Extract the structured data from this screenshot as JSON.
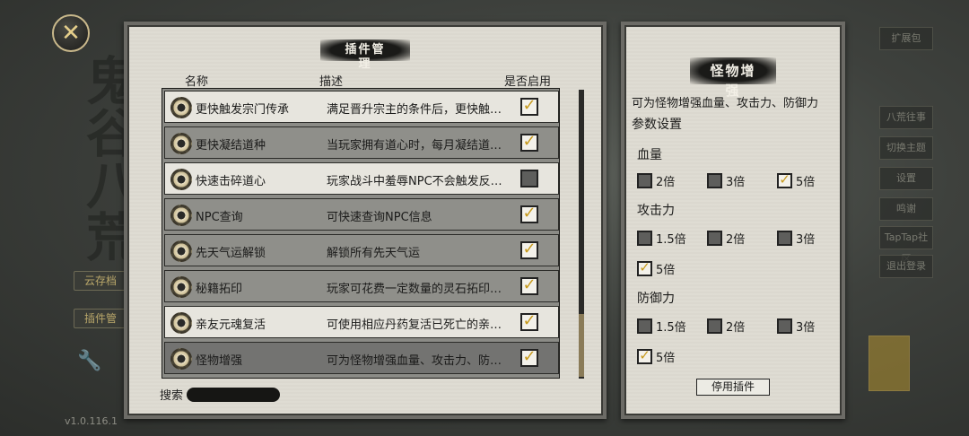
{
  "close_icon": "close-icon",
  "background": {
    "left_art": "鬼谷八荒",
    "side_buttons": [
      "云存档",
      "插件管"
    ],
    "right_buttons": [
      "扩展包",
      "八荒往事",
      "切换主题",
      "设置",
      "鸣谢",
      "TapTap社区",
      "退出登录"
    ],
    "version": "v1.0.116.1"
  },
  "main_panel": {
    "title": "插件管理",
    "columns": {
      "name": "名称",
      "desc": "描述",
      "enabled": "是否启用"
    },
    "plugins": [
      {
        "name": "更快触发宗门传承",
        "desc": "满足晋升宗主的条件后，更快触…",
        "enabled": true,
        "style": "light"
      },
      {
        "name": "更快凝结道种",
        "desc": "当玩家拥有道心时，每月凝结道…",
        "enabled": true,
        "style": "dark"
      },
      {
        "name": "快速击碎道心",
        "desc": "玩家战斗中羞辱NPC不会触发反…",
        "enabled": false,
        "style": "light"
      },
      {
        "name": "NPC查询",
        "desc": "可快速查询NPC信息",
        "enabled": true,
        "style": "dark"
      },
      {
        "name": "先天气运解锁",
        "desc": "解锁所有先天气运",
        "enabled": true,
        "style": "dark"
      },
      {
        "name": "秘籍拓印",
        "desc": "玩家可花费一定数量的灵石拓印…",
        "enabled": true,
        "style": "dark"
      },
      {
        "name": "亲友元魂复活",
        "desc": "可使用相应丹药复活已死亡的亲…",
        "enabled": true,
        "style": "light"
      },
      {
        "name": "怪物增强",
        "desc": "可为怪物增强血量、攻击力、防…",
        "enabled": true,
        "style": "selected"
      }
    ],
    "search_label": "搜索",
    "search_value": ""
  },
  "side_panel": {
    "title": "怪物增强",
    "desc": "可为怪物增强血量、攻击力、防御力",
    "params_label": "参数设置",
    "groups": [
      {
        "label": "血量",
        "options": [
          {
            "label": "2倍",
            "checked": false
          },
          {
            "label": "3倍",
            "checked": false
          },
          {
            "label": "5倍",
            "checked": true
          }
        ]
      },
      {
        "label": "攻击力",
        "options": [
          {
            "label": "1.5倍",
            "checked": false
          },
          {
            "label": "2倍",
            "checked": false
          },
          {
            "label": "3倍",
            "checked": false
          },
          {
            "label": "5倍",
            "checked": true
          }
        ]
      },
      {
        "label": "防御力",
        "options": [
          {
            "label": "1.5倍",
            "checked": false
          },
          {
            "label": "2倍",
            "checked": false
          },
          {
            "label": "3倍",
            "checked": false
          },
          {
            "label": "5倍",
            "checked": true
          }
        ]
      }
    ],
    "disable_button": "停用插件"
  },
  "colors": {
    "panel_bg": "#dedbd2",
    "row_light": "#e7e5de",
    "row_dark": "#8f8f8a",
    "row_selected": "#737371",
    "tick": "#c79a1d"
  }
}
